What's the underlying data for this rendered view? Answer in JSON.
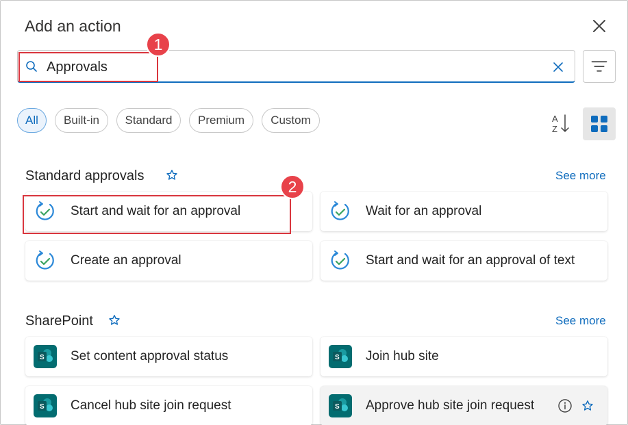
{
  "dialog": {
    "title": "Add an action"
  },
  "search": {
    "value": "Approvals"
  },
  "filters": [
    "All",
    "Built-in",
    "Standard",
    "Premium",
    "Custom"
  ],
  "callouts": [
    "1",
    "2"
  ],
  "sections": {
    "approvals": {
      "title": "Standard approvals",
      "see_more": "See more",
      "actions": [
        "Start and wait for an approval",
        "Wait for an approval",
        "Create an approval",
        "Start and wait for an approval of text"
      ]
    },
    "sharepoint": {
      "title": "SharePoint",
      "see_more": "See more",
      "actions": [
        "Set content approval status",
        "Join hub site",
        "Cancel hub site join request",
        "Approve hub site join request"
      ]
    }
  },
  "icons": {
    "close": "close-icon",
    "search": "search-icon",
    "clear": "clear-icon",
    "filter": "filter-lines-icon",
    "sort": "sort-az-icon",
    "grid": "grid-view-icon",
    "favorite": "star-outline-icon",
    "approval": "approval-check-icon",
    "sharepoint": "sharepoint-icon",
    "info": "info-icon"
  },
  "colors": {
    "accent": "#0f6cbd",
    "callout": "#e8424a",
    "sharepoint": "#036c70",
    "approval_arc": "#2b88d8",
    "approval_check": "#3aa35f"
  }
}
